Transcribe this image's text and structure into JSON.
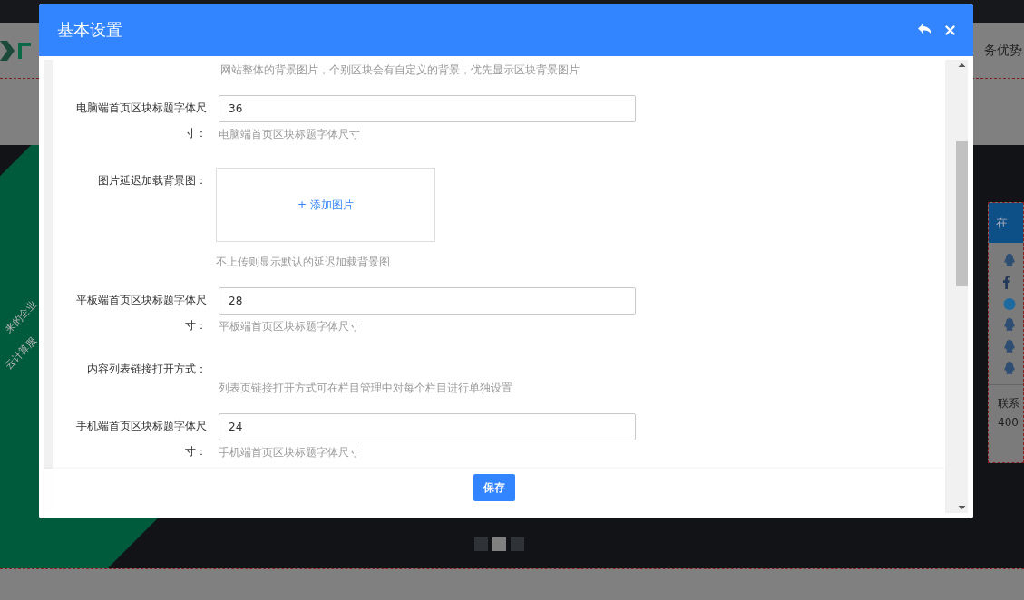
{
  "background": {
    "nav_right": "务优势",
    "banner_lines": [
      "来的企业",
      "云计算服"
    ],
    "chat": {
      "title": "在",
      "icons": [
        {
          "kind": "qq"
        },
        {
          "kind": "facebook"
        },
        {
          "kind": "bubble"
        },
        {
          "kind": "qq"
        },
        {
          "kind": "qq"
        },
        {
          "kind": "qq"
        }
      ],
      "contact_label": "联系",
      "contact_number": "400"
    },
    "carousel": [
      {
        "selected": false
      },
      {
        "selected": true
      },
      {
        "selected": false
      }
    ]
  },
  "dialog": {
    "title": "基本设置",
    "top_hint": "网站整体的背景图片，个别区块会有自定义的背景，优先显示区块背景图片",
    "fields": [
      {
        "kind": "input",
        "label": "电脑端首页区块标题字体尺寸：",
        "value": "36",
        "hint": "电脑端首页区块标题字体尺寸"
      },
      {
        "kind": "image",
        "label": "图片延迟加载背景图：",
        "button": "+ 添加图片",
        "hint": "不上传则显示默认的延迟加载背景图"
      },
      {
        "kind": "input",
        "label": "平板端首页区块标题字体尺寸：",
        "value": "28",
        "hint": "平板端首页区块标题字体尺寸"
      },
      {
        "kind": "note",
        "label": "内容列表链接打开方式：",
        "hint": "列表页链接打开方式可在栏目管理中对每个栏目进行单独设置"
      },
      {
        "kind": "input",
        "label": "手机端首页区块标题字体尺寸：",
        "value": "24",
        "hint": "手机端首页区块标题字体尺寸"
      }
    ],
    "save": "保存"
  }
}
